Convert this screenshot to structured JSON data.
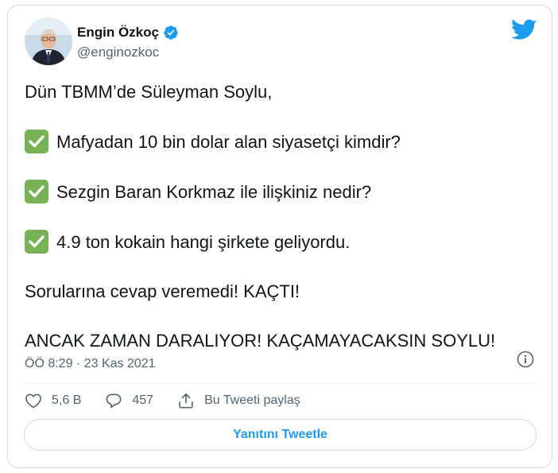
{
  "author": {
    "name": "Engin Özkoç",
    "handle": "@enginozkoc",
    "verified": true,
    "avatar_icon": "avatar-portrait"
  },
  "brand_icon": "twitter-bird-icon",
  "tweet": {
    "lines": [
      "Dün TBMM’de Süleyman Soylu,",
      "Mafyadan 10 bin dolar alan siyasetçi kimdir?",
      "Sezgin Baran Korkmaz ile ilişkiniz nedir?",
      "4.9 ton kokain hangi şirkete geliyordu.",
      "Sorularına cevap veremedi! KAÇTI!",
      "ANCAK ZAMAN DARALIYOR! KAÇAMAYACAKSIN SOYLU!"
    ],
    "check_icon": "check-mark-button-emoji"
  },
  "meta": {
    "timestamp": "ÖÖ 8:29 · 23 Kas 2021",
    "info_icon": "info-icon"
  },
  "actions": {
    "like_count": "5,6 B",
    "reply_count": "457",
    "share_label": "Bu Tweeti paylaş"
  },
  "reply_button_label": "Yanıtını Tweetle",
  "colors": {
    "brand_blue": "#1d9bf0",
    "check_green": "#77b255",
    "text_primary": "#0f1419",
    "text_secondary": "#536471",
    "border": "#cfd9de"
  }
}
